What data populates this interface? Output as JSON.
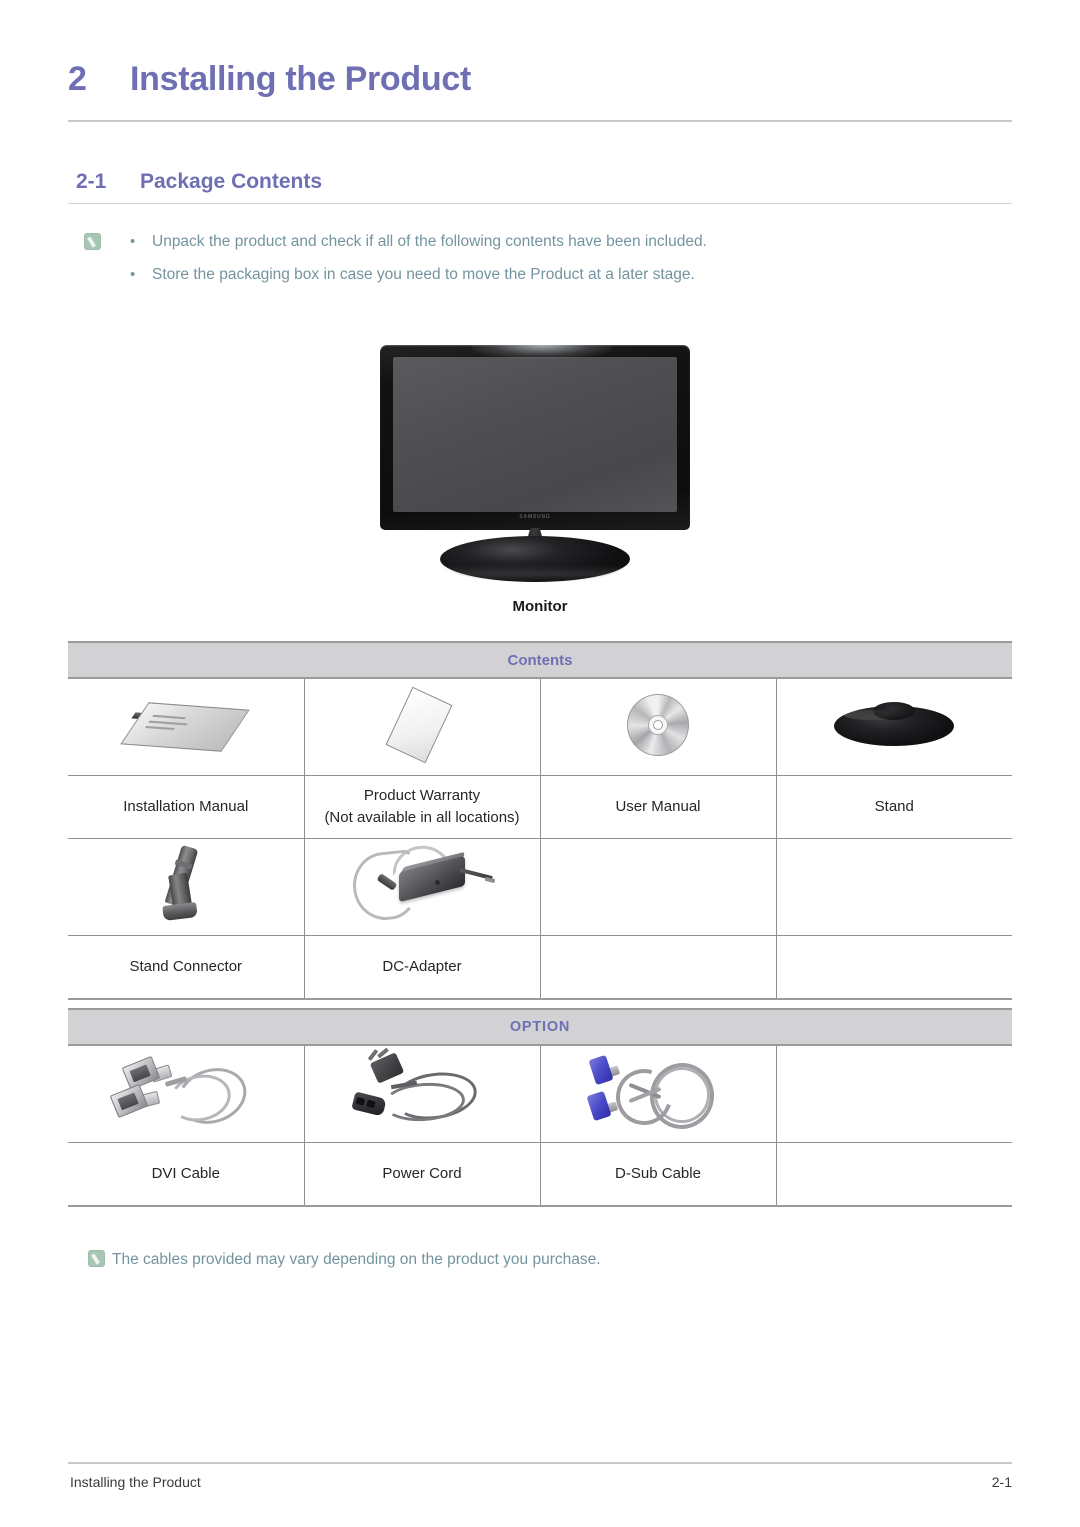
{
  "chapter": {
    "number": "2",
    "title": "Installing the Product"
  },
  "section": {
    "number": "2-1",
    "title": "Package Contents"
  },
  "notes": {
    "icon_name": "note-icon",
    "bullet": "•",
    "items": [
      "Unpack the product and check if all of the following contents have been included.",
      "Store the packaging box in case you need to move the Product at a later stage."
    ]
  },
  "monitor": {
    "image_alt": "monitor-illustration",
    "brand_logo": "SAMSUNG",
    "caption": "Monitor"
  },
  "contents_table": {
    "header": "Contents",
    "rows": [
      [
        {
          "art": "installation-manual",
          "label": "Installation Manual",
          "label2": ""
        },
        {
          "art": "product-warranty",
          "label": "Product Warranty",
          "label2": "(Not available in all locations)"
        },
        {
          "art": "user-manual-cd",
          "label": "User Manual",
          "label2": ""
        },
        {
          "art": "stand",
          "label": "Stand",
          "label2": ""
        }
      ],
      [
        {
          "art": "stand-connector",
          "label": "Stand Connector",
          "label2": ""
        },
        {
          "art": "dc-adapter",
          "label": "DC-Adapter",
          "label2": ""
        },
        {
          "art": "",
          "label": "",
          "label2": ""
        },
        {
          "art": "",
          "label": "",
          "label2": ""
        }
      ]
    ]
  },
  "option_table": {
    "header": "OPTION",
    "rows": [
      [
        {
          "art": "dvi-cable",
          "label": "DVI Cable",
          "label2": ""
        },
        {
          "art": "power-cord",
          "label": "Power Cord",
          "label2": ""
        },
        {
          "art": "d-sub-cable",
          "label": "D-Sub Cable",
          "label2": ""
        },
        {
          "art": "",
          "label": "",
          "label2": ""
        }
      ]
    ]
  },
  "footer_note": {
    "icon_name": "note-icon",
    "text": "The cables provided may vary depending on the product you purchase."
  },
  "page_footer": {
    "left": "Installing the Product",
    "right": "2-1"
  },
  "colors": {
    "heading": "#6f6fb4",
    "note_text": "#73949e",
    "band": "#d2d2d4",
    "rule": "#c9c9c9"
  }
}
